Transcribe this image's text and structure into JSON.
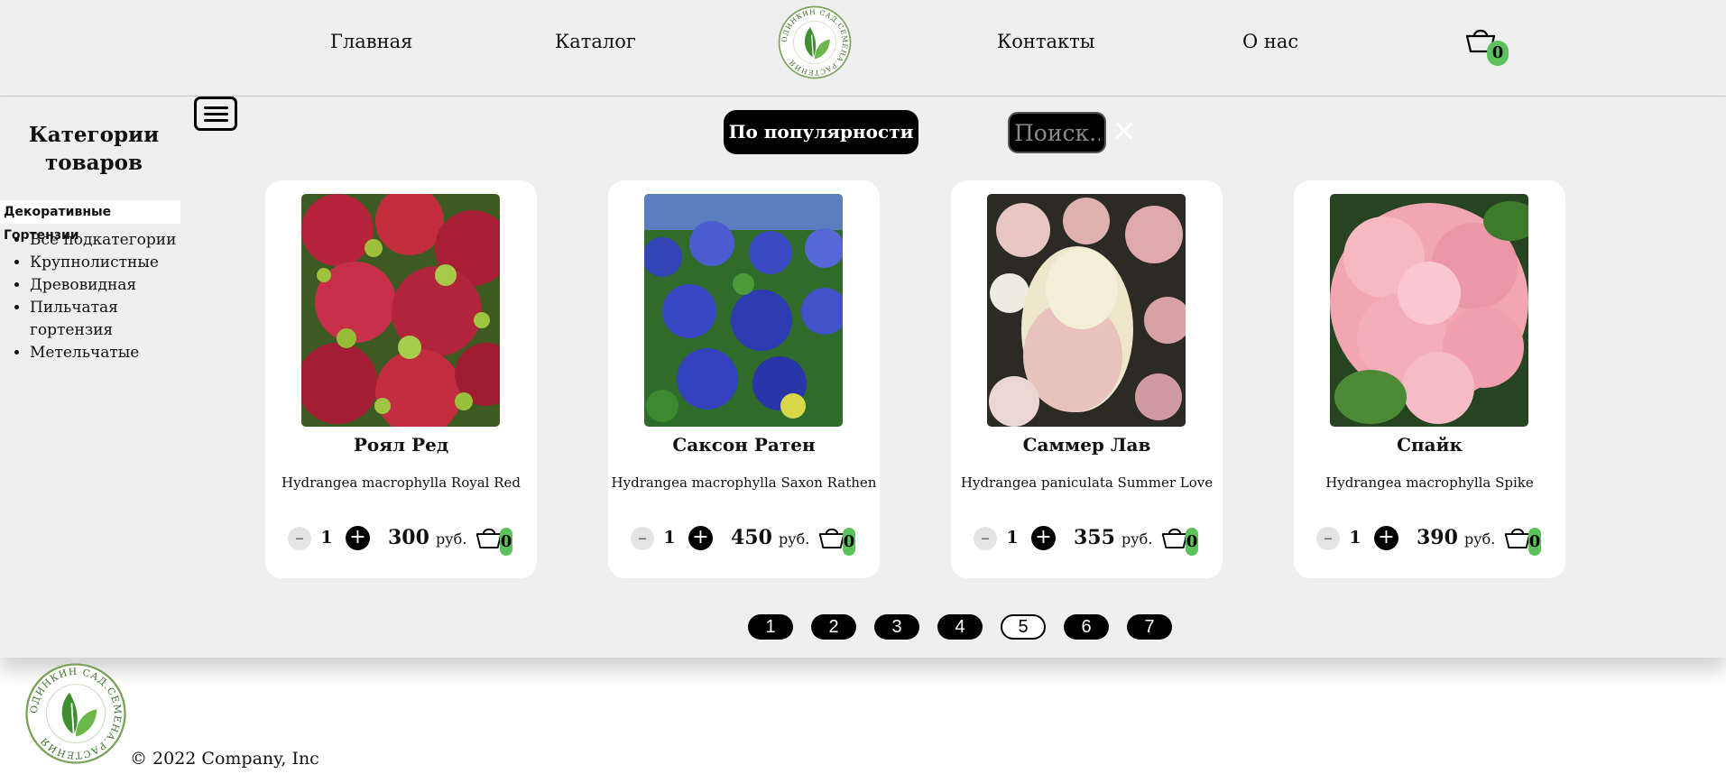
{
  "nav": {
    "items": [
      "Главная",
      "Каталог",
      "Контакты",
      "О нас"
    ],
    "cart_count": "0"
  },
  "logo": {
    "text": "ОДИНКИН САД.СЕМЕНА.РАСТЕНИЯ"
  },
  "sidebar": {
    "title": "Категории товаров",
    "category": "Декоративные Гортензии",
    "subcategories": [
      "Все подкатегории",
      "Крупнолистные",
      "Древовидная",
      "Пильчатая гортензия",
      "Метельчатые"
    ]
  },
  "toolbar": {
    "sort_label": "По популярности",
    "search_placeholder": "Поиск...",
    "close_symbol": "✕"
  },
  "products": [
    {
      "name": "Роял Ред",
      "latin": "Hydrangea macrophylla Royal Red",
      "qty": "1",
      "price": "300",
      "currency": "руб.",
      "cart_count": "0"
    },
    {
      "name": "Саксон Ратен",
      "latin": "Hydrangea macrophylla Saxon Rathen",
      "qty": "1",
      "price": "450",
      "currency": "руб.",
      "cart_count": "0"
    },
    {
      "name": "Саммер Лав",
      "latin": "Hydrangea paniculata Summer Love",
      "qty": "1",
      "price": "355",
      "currency": "руб.",
      "cart_count": "0"
    },
    {
      "name": "Спайк",
      "latin": "Hydrangea macrophylla Spike",
      "qty": "1",
      "price": "390",
      "currency": "руб.",
      "cart_count": "0"
    }
  ],
  "qty_controls": {
    "minus": "–",
    "plus": "+"
  },
  "pagination": {
    "pages": [
      "1",
      "2",
      "3",
      "4",
      "5",
      "6",
      "7"
    ],
    "current": "5"
  },
  "footer": {
    "copyright": "© 2022 Company, Inc"
  },
  "colors": {
    "accent_green": "#5cc25c",
    "background": "#efefef",
    "card": "#ffffff",
    "button": "#000000"
  }
}
